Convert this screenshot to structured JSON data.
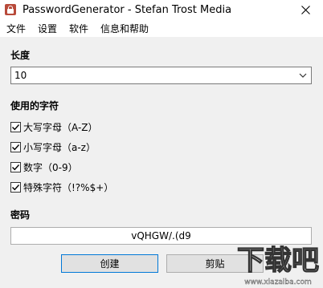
{
  "window": {
    "title": "PasswordGenerator - Stefan Trost Media"
  },
  "menu": {
    "items": [
      "文件",
      "设置",
      "软件",
      "信息和帮助"
    ]
  },
  "length": {
    "label": "长度",
    "value": "10"
  },
  "chars": {
    "label": "使用的字符",
    "options": [
      {
        "label": "大写字母（A-Z）",
        "checked": true
      },
      {
        "label": "小写字母（a-z）",
        "checked": true
      },
      {
        "label": "数字（0-9）",
        "checked": true
      },
      {
        "label": "特殊字符（!?%$+）",
        "checked": true
      }
    ]
  },
  "password": {
    "label": "密码",
    "value": "vQHGW/.(d9"
  },
  "buttons": {
    "create": "创建",
    "copy": "剪贴"
  },
  "watermark": {
    "text": "下载吧",
    "url": "www.xiazaiba.com"
  },
  "colors": {
    "focus_border": "#0078d7",
    "icon_red": "#b84a3a"
  }
}
